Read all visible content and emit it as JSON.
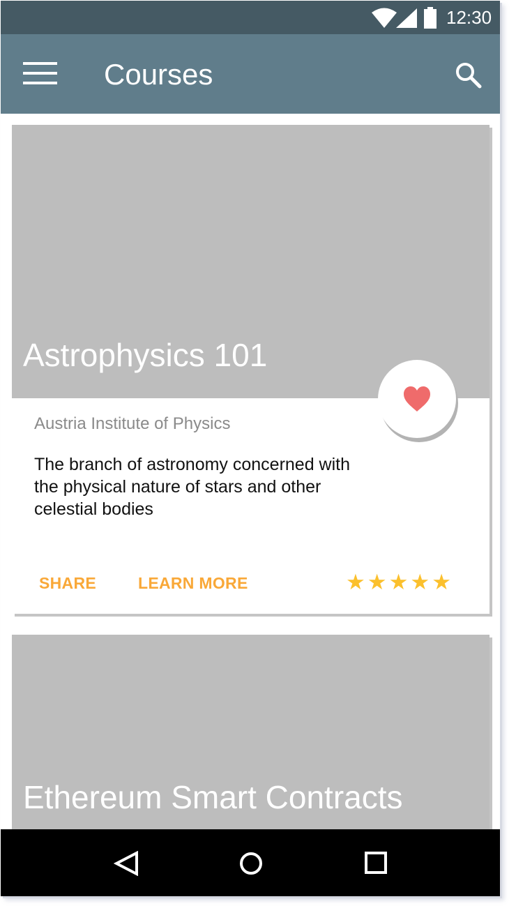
{
  "status_bar": {
    "time": "12:30",
    "icons": [
      "wifi-icon",
      "signal-icon",
      "battery-icon"
    ]
  },
  "app_bar": {
    "title": "Courses",
    "menu_icon": "hamburger-menu-icon",
    "search_icon": "search-icon",
    "color": "#607d8b"
  },
  "courses": [
    {
      "title": "Astrophysics 101",
      "institution": "Austria Institute of Physics",
      "description": "The branch of astronomy concerned with the physical nature of stars and other celestial bodies",
      "share_label": "SHARE",
      "learn_more_label": "LEARN MORE",
      "rating": 5,
      "rating_max": 5,
      "favorite": true
    },
    {
      "title": "Ethereum Smart Contracts"
    }
  ],
  "nav_bar": {
    "icons": [
      "back-icon",
      "home-icon",
      "recents-icon"
    ]
  },
  "colors": {
    "status_bar": "#455a64",
    "app_bar": "#607d8b",
    "media_placeholder": "#bdbdbd",
    "action_text": "#f9a838",
    "star": "#fbc02d",
    "heart": "#ef6b6b"
  }
}
